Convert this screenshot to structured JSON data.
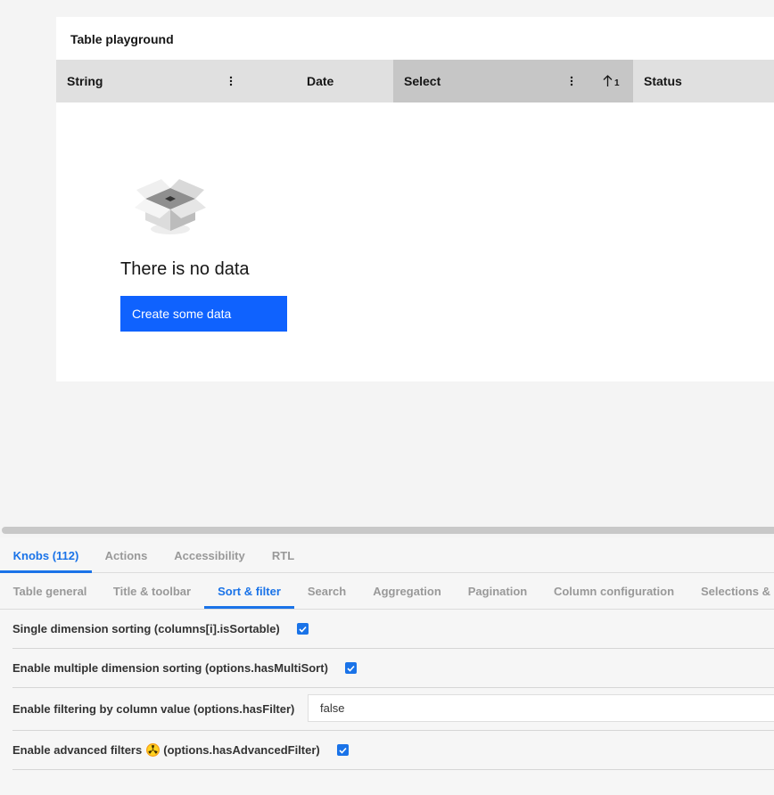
{
  "table": {
    "title": "Table playground",
    "columns": [
      {
        "label": "String"
      },
      {
        "label": "Date"
      },
      {
        "label": "Select",
        "sort_order": "1"
      },
      {
        "label": "Status"
      }
    ],
    "empty_state": {
      "title": "There is no data",
      "button_label": "Create some data"
    }
  },
  "addons": {
    "tabs": [
      {
        "label": "Knobs (112)",
        "active": true
      },
      {
        "label": "Actions"
      },
      {
        "label": "Accessibility"
      },
      {
        "label": "RTL"
      }
    ],
    "groups": [
      {
        "label": "Table general"
      },
      {
        "label": "Title & toolbar"
      },
      {
        "label": "Sort & filter",
        "active": true
      },
      {
        "label": "Search"
      },
      {
        "label": "Aggregation"
      },
      {
        "label": "Pagination"
      },
      {
        "label": "Column configuration"
      },
      {
        "label": "Selections &"
      }
    ],
    "knobs": {
      "single_sort": {
        "label": "Single dimension sorting (columns[i].isSortable)",
        "checked": true
      },
      "multi_sort": {
        "label": "Enable multiple dimension sorting (options.hasMultiSort)",
        "checked": true
      },
      "has_filter": {
        "label": "Enable filtering by column value (options.hasFilter)",
        "value": "false"
      },
      "adv_filter": {
        "label_before": "Enable advanced filters",
        "label_after": "(options.hasAdvancedFilter)",
        "icon": "radioactive-icon",
        "checked": true
      }
    },
    "colors": {
      "accent": "#1a73e8",
      "primary_button": "#0f62fe"
    }
  }
}
